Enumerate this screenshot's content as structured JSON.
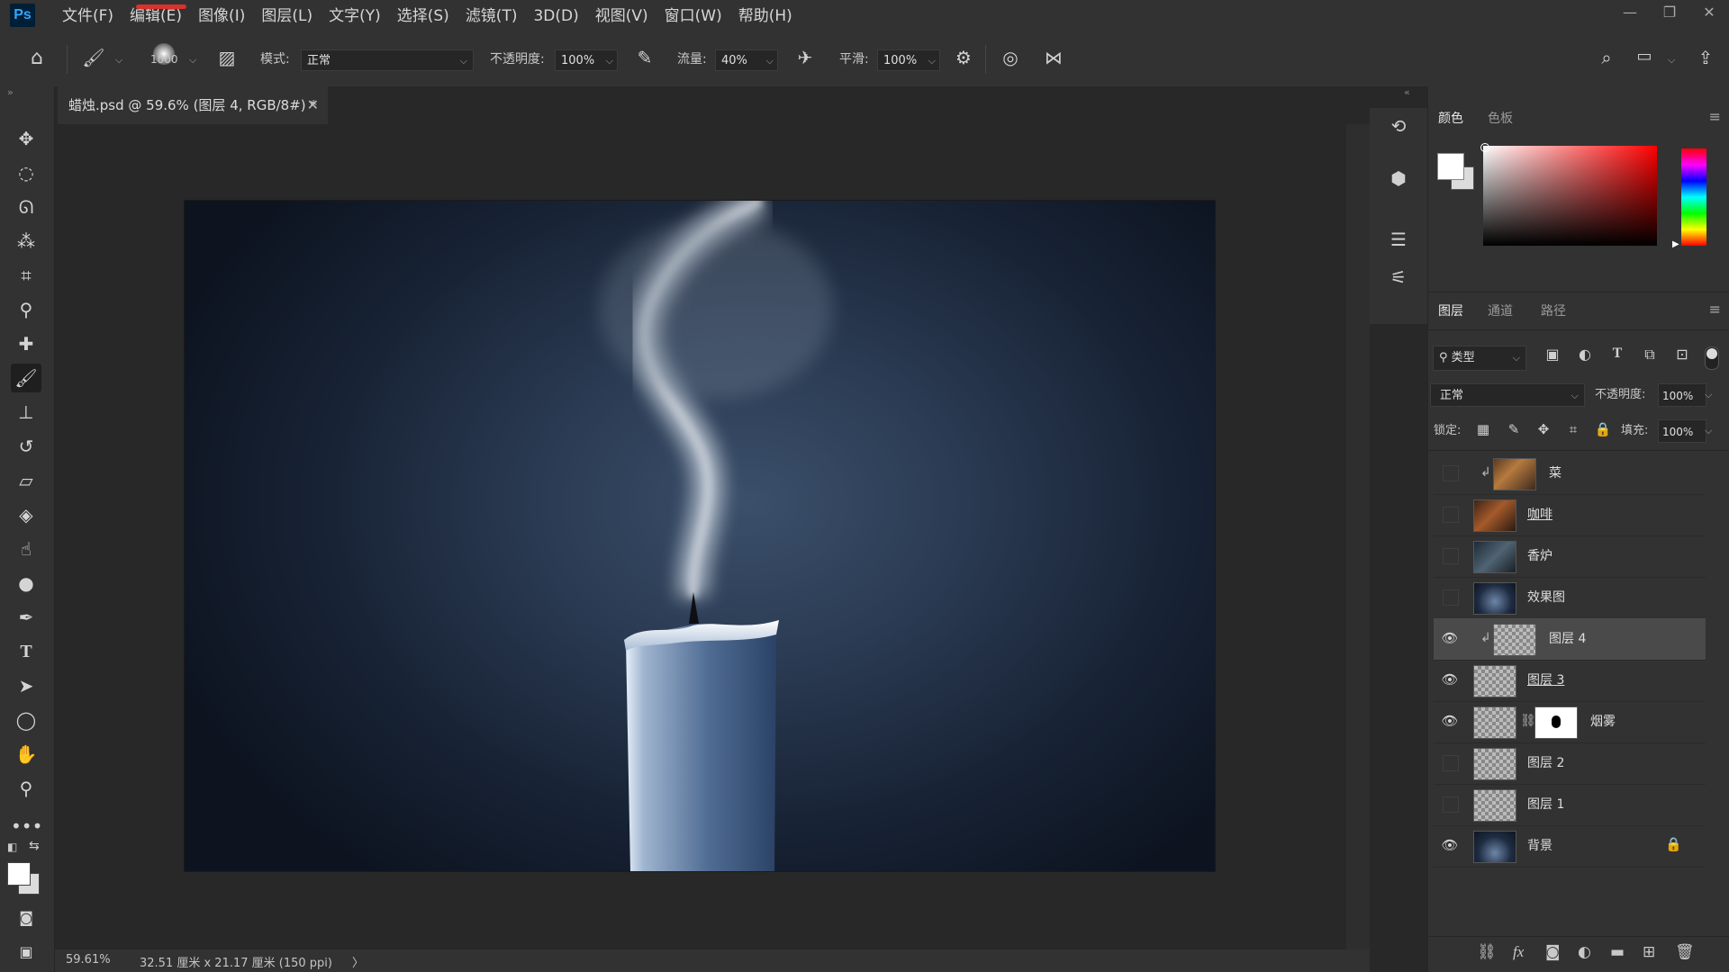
{
  "app": {
    "logo": "Ps"
  },
  "menu": [
    "文件(F)",
    "编辑(E)",
    "图像(I)",
    "图层(L)",
    "文字(Y)",
    "选择(S)",
    "滤镜(T)",
    "3D(D)",
    "视图(V)",
    "窗口(W)",
    "帮助(H)"
  ],
  "window_controls": {
    "minimize": "—",
    "restore": "❐",
    "close": "✕"
  },
  "options": {
    "brush_size": "1000",
    "mode_label": "模式:",
    "mode_value": "正常",
    "opacity_label": "不透明度:",
    "opacity_value": "100%",
    "flow_label": "流量:",
    "flow_value": "40%",
    "smooth_label": "平滑:",
    "smooth_value": "100%"
  },
  "document": {
    "tab_title": "蜡烛.psd @ 59.6% (图层 4, RGB/8#) *",
    "close": "✕",
    "zoom": "59.61%",
    "dimensions": "32.51 厘米 x 21.17 厘米 (150 ppi)",
    "status_arrow": "〉"
  },
  "color_panel": {
    "tabs": [
      "颜色",
      "色板"
    ],
    "active_tab": 0,
    "foreground": "#ffffff",
    "background": "#dcdcdc"
  },
  "layers_panel": {
    "tabs": [
      "图层",
      "通道",
      "路径"
    ],
    "filter_label": "类型",
    "blend_mode": "正常",
    "opacity_label": "不透明度:",
    "opacity_value": "100%",
    "lock_label": "锁定:",
    "fill_label": "填充:",
    "fill_value": "100%",
    "layers": [
      {
        "name": "菜",
        "visible": false,
        "clipped": true,
        "selected": false
      },
      {
        "name": "咖啡",
        "visible": false,
        "clipped": false,
        "selected": false
      },
      {
        "name": "香炉",
        "visible": false,
        "clipped": false,
        "selected": false
      },
      {
        "name": "效果图",
        "visible": false,
        "clipped": false,
        "selected": false
      },
      {
        "name": "图层 4",
        "visible": true,
        "clipped": true,
        "selected": true
      },
      {
        "name": "图层 3",
        "visible": true,
        "clipped": false,
        "selected": false
      },
      {
        "name": "烟雾",
        "visible": true,
        "clipped": false,
        "selected": false,
        "mask": true
      },
      {
        "name": "图层 2",
        "visible": false,
        "clipped": false,
        "selected": false
      },
      {
        "name": "图层 1",
        "visible": false,
        "clipped": false,
        "selected": false
      },
      {
        "name": "背景",
        "visible": true,
        "clipped": false,
        "selected": false,
        "locked": true
      }
    ]
  },
  "colors": {
    "ui_dark": "#282828",
    "ui_panel": "#323232",
    "selected_layer": "#4a4a4a"
  }
}
